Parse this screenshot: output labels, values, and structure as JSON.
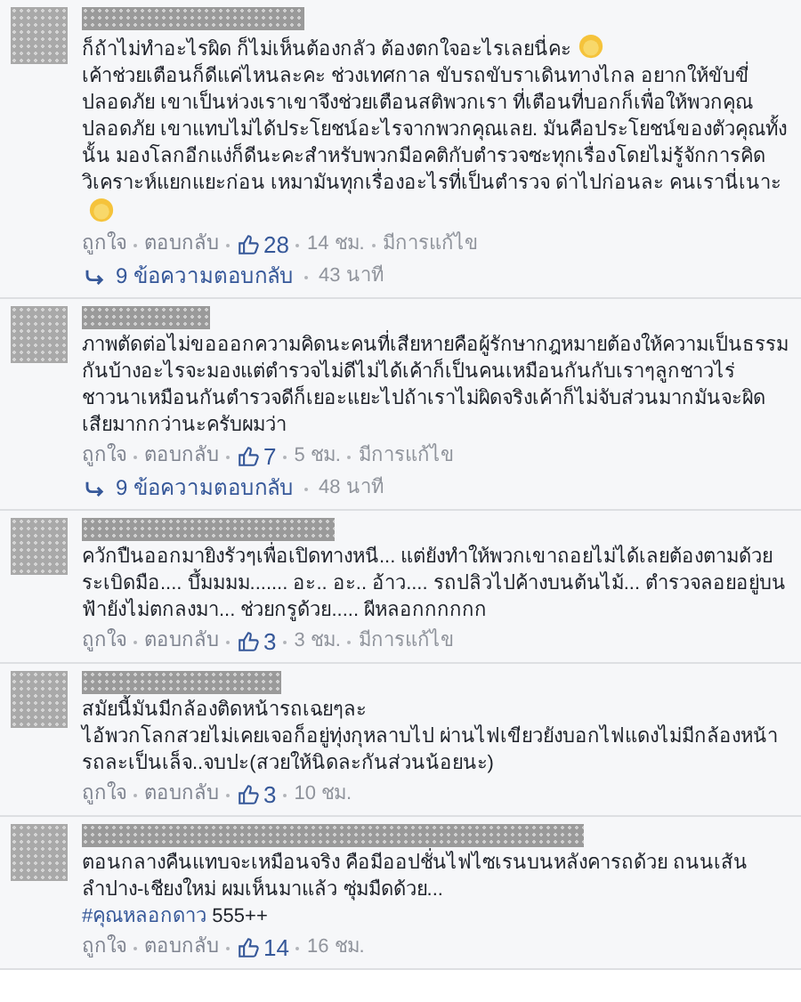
{
  "comments": [
    {
      "paragraphs": [
        {
          "text": "ก็ถ้าไม่ทำอะไรผิด ก็ไม่เห็นต้องกลัว ต้องตกใจอะไรเลยนี่คะ",
          "emoji": true
        },
        {
          "text": "เค้าช่วยเตือนก็ดีแค่ไหนละคะ ช่วงเทศกาล ขับรถขับราเดินทางไกล อยากให้ขับขี่ปลอดภัย เขาเป็นห่วงเราเขาจึงช่วยเตือนสติพวกเรา ที่เตือนที่บอกก็เพื่อให้พวกคุณปลอดภัย เขาแทบไม่ได้ประโยชน์อะไรจากพวกคุณเลย. มันคือประโยชน์ของตัวคุณทั้งนั้น มองโลกอีกแง่ก็ดีนะคะสำหรับพวกมีอคติกับตำรวจซะทุกเรื่องโดยไม่รู้จักการคิดวิเคราะห์แยกแยะก่อน เหมามันทุกเรื่องอะไรที่เป็นตำรวจ ด่าไปก่อนละ คนเรานี่เนาะ",
          "emoji": true
        }
      ],
      "like": "ถูกใจ",
      "reply": "ตอบกลับ",
      "likes": "28",
      "time": "14 ชม.",
      "edited": "มีการแก้ไข",
      "replies": {
        "count": "9 ข้อความตอบกลับ",
        "time": "43 นาที"
      }
    },
    {
      "paragraphs": [
        {
          "text": "ภาพตัดต่อไม่ขอออกความคิดนะคนที่เสียหายคือผู้รักษากฎหมายต้องให้ความเป็นธรรมกันบ้างอะไรจะมองแต่ตำรวจไม่ดีไม่ได้เค้าก็เป็นคนเหมือนกันกับเราๆลูกชาวไร่ชาวนาเหมือนกันตำรวจดีก็เยอะแยะไปถ้าเราไม่ผิดจริงเค้าก็ไม่จับส่วนมากมันจะผิดเสียมากกว่านะครับผมว่า",
          "emoji": false
        }
      ],
      "like": "ถูกใจ",
      "reply": "ตอบกลับ",
      "likes": "7",
      "time": "5 ชม.",
      "edited": "มีการแก้ไข",
      "replies": {
        "count": "9 ข้อความตอบกลับ",
        "time": "48 นาที"
      }
    },
    {
      "paragraphs": [
        {
          "text": "ควักปืนออกมายิงรัวๆเพื่อเปิดทางหนี... แต่ยังทำให้พวกเขาถอยไม่ได้เลยต้องตามด้วยระเบิดมือ.... บึ้มมมม....... อะ.. อะ.. อ้าว.... รถปลิวไปค้างบนต้นไม้... ตำรวจลอยอยู่บนฟ้ายังไม่ตกลงมา... ช่วยกรูด้วย..... ผีหลอกกกกกก",
          "emoji": false
        }
      ],
      "like": "ถูกใจ",
      "reply": "ตอบกลับ",
      "likes": "3",
      "time": "3 ชม.",
      "edited": "มีการแก้ไข"
    },
    {
      "paragraphs": [
        {
          "text": "สมัยนี้มันมีกล้องติดหน้ารถเฉยๆละ",
          "emoji": false
        },
        {
          "text": "ไอ้พวกโลกสวยไม่เคยเจอก็อยู่ทุ่งกุหลาบไป ผ่านไฟเขียวยังบอกไฟแดงไม่มีกล้องหน้ารถละเป็นเล็จ..จบปะ(สวยให้นิดละกันส่วนน้อยนะ)",
          "emoji": false
        }
      ],
      "like": "ถูกใจ",
      "reply": "ตอบกลับ",
      "likes": "3",
      "time": "10 ชม."
    },
    {
      "paragraphs": [
        {
          "text": "ตอนกลางคืนแทบจะเหมือนจริง คือมีออปชั่นไฟไซเรนบนหลังคารถด้วย ถนนเส้น ลำปาง-เชียงใหม่ ผมเห็นมาแล้ว ซุ่มมืดด้วย...",
          "emoji": false
        },
        {
          "hashtag": "#คุณหลอกดาว",
          "text": "555++",
          "emoji": false
        }
      ],
      "like": "ถูกใจ",
      "reply": "ตอบกลับ",
      "likes": "14",
      "time": "16 ชม."
    }
  ]
}
